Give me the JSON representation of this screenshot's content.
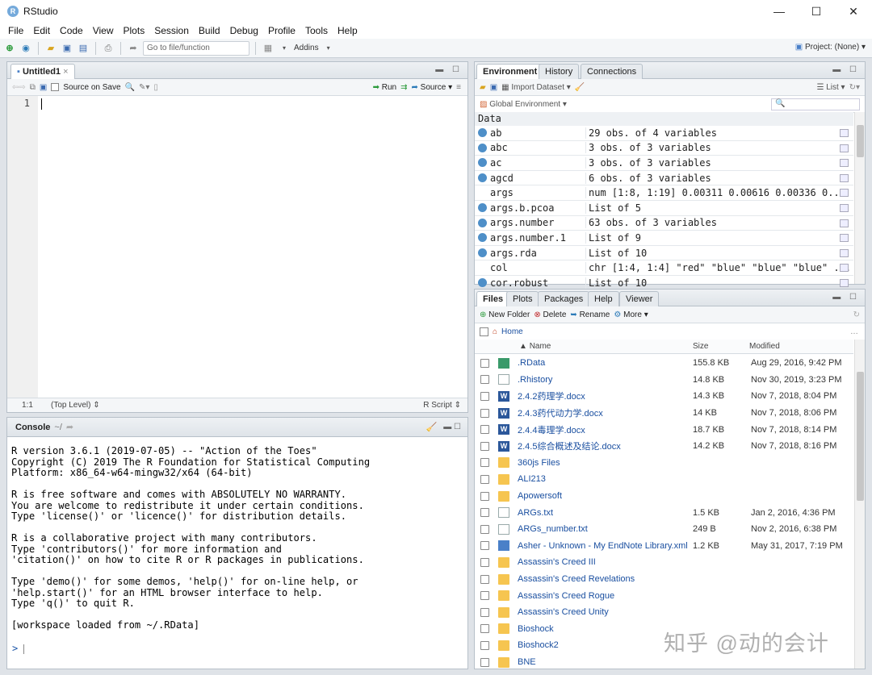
{
  "window": {
    "title": "RStudio",
    "controls": [
      "—",
      "☐",
      "✕"
    ]
  },
  "menu": [
    "File",
    "Edit",
    "Code",
    "View",
    "Plots",
    "Session",
    "Build",
    "Debug",
    "Profile",
    "Tools",
    "Help"
  ],
  "toolbar": {
    "goto_placeholder": "Go to file/function",
    "addins": "Addins",
    "project": "Project: (None)"
  },
  "source": {
    "tab": "Untitled1",
    "source_on_save": "Source on Save",
    "run": "Run",
    "source_btn": "Source",
    "line": "1",
    "pos": "1:1",
    "scope": "(Top Level)",
    "filetype": "R Script"
  },
  "console": {
    "title": "Console",
    "path": "~/",
    "lines": "R version 3.6.1 (2019-07-05) -- \"Action of the Toes\"\nCopyright (C) 2019 The R Foundation for Statistical Computing\nPlatform: x86_64-w64-mingw32/x64 (64-bit)\n\nR is free software and comes with ABSOLUTELY NO WARRANTY.\nYou are welcome to redistribute it under certain conditions.\nType 'license()' or 'licence()' for distribution details.\n\nR is a collaborative project with many contributors.\nType 'contributors()' for more information and\n'citation()' on how to cite R or R packages in publications.\n\nType 'demo()' for some demos, 'help()' for on-line help, or\n'help.start()' for an HTML browser interface to help.\nType 'q()' to quit R.\n\n[workspace loaded from ~/.RData]",
    "prompt": ">"
  },
  "env": {
    "tabs": [
      "Environment",
      "History",
      "Connections"
    ],
    "import": "Import Dataset",
    "list": "List",
    "global": "Global Environment",
    "section": "Data",
    "rows": [
      {
        "name": "ab",
        "value": "29 obs. of 4 variables",
        "icon": true
      },
      {
        "name": "abc",
        "value": "3 obs. of 3 variables",
        "icon": true
      },
      {
        "name": "ac",
        "value": "3 obs. of 3 variables",
        "icon": true
      },
      {
        "name": "agcd",
        "value": "6 obs. of 3 variables",
        "icon": true
      },
      {
        "name": "args",
        "value": "num [1:8, 1:19] 0.00311 0.00616 0.00336 0...",
        "icon": false
      },
      {
        "name": "args.b.pcoa",
        "value": "List of 5",
        "icon": true
      },
      {
        "name": "args.number",
        "value": "63 obs. of 3 variables",
        "icon": true
      },
      {
        "name": "args.number.1",
        "value": "List of 9",
        "icon": true
      },
      {
        "name": "args.rda",
        "value": "List of 10",
        "icon": true
      },
      {
        "name": "col",
        "value": "chr [1:4, 1:4] \"red\" \"blue\" \"blue\" \"blue\" ...",
        "icon": false
      },
      {
        "name": "cor.robust",
        "value": "List of 10",
        "icon": true
      }
    ]
  },
  "files": {
    "tabs": [
      "Files",
      "Plots",
      "Packages",
      "Help",
      "Viewer"
    ],
    "new_folder": "New Folder",
    "delete": "Delete",
    "rename": "Rename",
    "more": "More",
    "home": "Home",
    "headers": {
      "name": "Name",
      "size": "Size",
      "modified": "Modified"
    },
    "rows": [
      {
        "name": ".RData",
        "size": "155.8 KB",
        "modified": "Aug 29, 2016, 9:42 PM",
        "type": "rdata"
      },
      {
        "name": ".Rhistory",
        "size": "14.8 KB",
        "modified": "Nov 30, 2019, 3:23 PM",
        "type": "doc"
      },
      {
        "name": "2.4.2药理学.docx",
        "size": "14.3 KB",
        "modified": "Nov 7, 2018, 8:04 PM",
        "type": "word"
      },
      {
        "name": "2.4.3药代动力学.docx",
        "size": "14 KB",
        "modified": "Nov 7, 2018, 8:06 PM",
        "type": "word"
      },
      {
        "name": "2.4.4毒理学.docx",
        "size": "18.7 KB",
        "modified": "Nov 7, 2018, 8:14 PM",
        "type": "word"
      },
      {
        "name": "2.4.5综合概述及结论.docx",
        "size": "14.2 KB",
        "modified": "Nov 7, 2018, 8:16 PM",
        "type": "word"
      },
      {
        "name": "360js Files",
        "size": "",
        "modified": "",
        "type": "folder"
      },
      {
        "name": "ALI213",
        "size": "",
        "modified": "",
        "type": "folder"
      },
      {
        "name": "Apowersoft",
        "size": "",
        "modified": "",
        "type": "folder"
      },
      {
        "name": "ARGs.txt",
        "size": "1.5 KB",
        "modified": "Jan 2, 2016, 4:36 PM",
        "type": "doc"
      },
      {
        "name": "ARGs_number.txt",
        "size": "249 B",
        "modified": "Nov 2, 2016, 6:38 PM",
        "type": "doc"
      },
      {
        "name": "Asher - Unknown - My EndNote Library.xml",
        "size": "1.2 KB",
        "modified": "May 31, 2017, 7:19 PM",
        "type": "xml"
      },
      {
        "name": "Assassin's Creed III",
        "size": "",
        "modified": "",
        "type": "folder"
      },
      {
        "name": "Assassin's Creed Revelations",
        "size": "",
        "modified": "",
        "type": "folder"
      },
      {
        "name": "Assassin's Creed Rogue",
        "size": "",
        "modified": "",
        "type": "folder"
      },
      {
        "name": "Assassin's Creed Unity",
        "size": "",
        "modified": "",
        "type": "folder"
      },
      {
        "name": "Bioshock",
        "size": "",
        "modified": "",
        "type": "folder"
      },
      {
        "name": "Bioshock2",
        "size": "",
        "modified": "",
        "type": "folder"
      },
      {
        "name": "BNE",
        "size": "",
        "modified": "",
        "type": "folder"
      }
    ]
  },
  "watermark": "知乎 @动的会计"
}
